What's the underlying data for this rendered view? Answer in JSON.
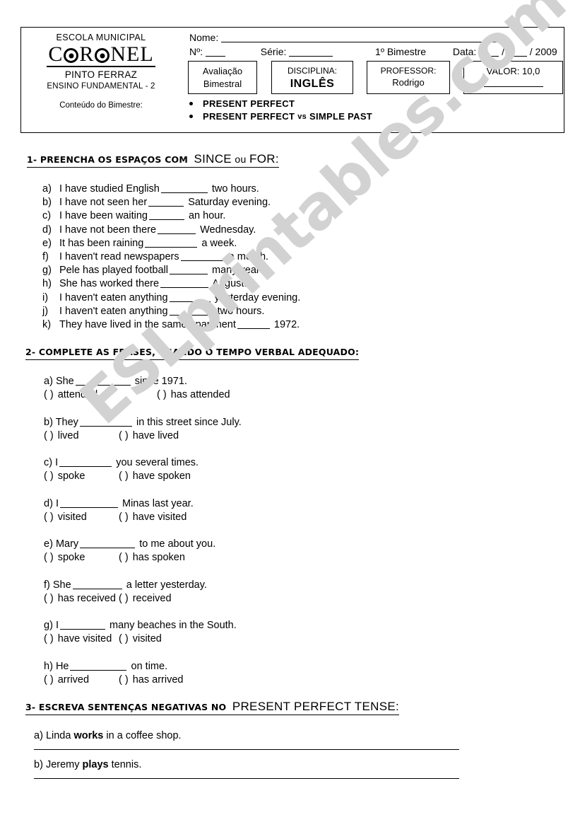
{
  "header": {
    "school": {
      "line1": "ESCOLA MUNICIPAL",
      "logo_part1": "C",
      "logo_part2": "R",
      "logo_part3": "NEL",
      "line3": "PINTO FERRAZ",
      "line4": "ENSINO FUNDAMENTAL - 2",
      "conteudo_label": "Conteúdo do Bimestre:"
    },
    "fields": {
      "nome_label": "Nome:",
      "numero_label": "Nº:",
      "serie_label": "Série:",
      "bimestre": "1º Bimestre",
      "data_label": "Data:",
      "data_sep1": "/",
      "data_sep2": "/ 2009"
    },
    "cells": {
      "avaliacao_line1": "Avaliação",
      "avaliacao_line2": "Bimestral",
      "disciplina_label": "DISCIPLINA:",
      "disciplina_value": "INGLÊS",
      "professor_label": "PROFESSOR:",
      "professor_value": "Rodrigo",
      "valor_label": "VALOR: 10,0"
    },
    "topics": [
      {
        "text": "PRESENT PERFECT"
      },
      {
        "part1": "PRESENT PERFECT",
        "part2": "vs",
        "part3": "SIMPLE PAST"
      }
    ]
  },
  "watermark": {
    "text": "ESLprintables.com",
    "color": "#d2d2d2"
  },
  "exercise1": {
    "heading_bold": "1- PREENCHA OS ESPAÇOS COM",
    "heading_light_1": "SINCE",
    "heading_light_2": "ou",
    "heading_light_3": "FOR:",
    "items": [
      {
        "letter": "a)",
        "before": "I have studied English",
        "blank": 66,
        "after": "two hours."
      },
      {
        "letter": "b)",
        "before": "I have not seen her",
        "blank": 50,
        "after": "Saturday evening."
      },
      {
        "letter": "c)",
        "before": "I have been waiting",
        "blank": 50,
        "after": "an hour."
      },
      {
        "letter": "d)",
        "before": "I have not been there",
        "blank": 54,
        "after": "Wednesday."
      },
      {
        "letter": "e)",
        "before": "It has been raining",
        "blank": 74,
        "after": "a week."
      },
      {
        "letter": "f)",
        "before": "I haven't read newspapers",
        "blank": 62,
        "after": "a month."
      },
      {
        "letter": "g)",
        "before": "Pele has played football",
        "blank": 54,
        "after": "many years."
      },
      {
        "letter": "h)",
        "before": "She has worked there",
        "blank": 68,
        "after": "August."
      },
      {
        "letter": "i)",
        "before": "I haven't eaten anything",
        "blank": 58,
        "after": "yesterday evening."
      },
      {
        "letter": "j)",
        "before": "I haven't eaten anything",
        "blank": 62,
        "after": "two hours."
      },
      {
        "letter": "k)",
        "before": "They have lived in the same apartment",
        "blank": 46,
        "after": "1972."
      }
    ]
  },
  "exercise2": {
    "heading_bold": "2- COMPLETE AS FRASES, USANDO O TEMPO VERBAL ADEQUADO:",
    "items": [
      {
        "letter": "a)",
        "before": "She",
        "blank": 78,
        "after": "since 1971.",
        "opt1": "attended",
        "opt2": "has attended",
        "opt_gap": 160
      },
      {
        "letter": "b)",
        "before": "They",
        "blank": 74,
        "after": "in this street since July.",
        "opt1": "lived",
        "opt2": "have lived",
        "opt_gap": 106
      },
      {
        "letter": "c)",
        "before": "I",
        "blank": 74,
        "after": "you several times.",
        "opt1": "spoke",
        "opt2": "have spoken",
        "opt_gap": 106
      },
      {
        "letter": "d)",
        "before": "I",
        "blank": 82,
        "after": "Minas last year.",
        "opt1": "visited",
        "opt2": "have visited",
        "opt_gap": 106
      },
      {
        "letter": "e)",
        "before": "Mary",
        "blank": 78,
        "after": "to me about you.",
        "opt1": "spoke",
        "opt2": "has spoken",
        "opt_gap": 106
      },
      {
        "letter": "f)",
        "before": "She",
        "blank": 70,
        "after": "a letter yesterday.",
        "opt1": "has received",
        "opt2": "received",
        "opt_gap": 106
      },
      {
        "letter": "g)",
        "before": "I",
        "blank": 64,
        "after": "many beaches in the South.",
        "opt1": "have visited",
        "opt2": "visited",
        "opt_gap": 106
      },
      {
        "letter": "h)",
        "before": "He",
        "blank": 80,
        "after": "on time.",
        "opt1": "arrived",
        "opt2": "has arrived",
        "opt_gap": 106
      }
    ],
    "paren_open": "(",
    "paren_close": ")"
  },
  "exercise3": {
    "heading_bold": "3- ESCREVA SENTENÇAS NEGATIVAS NO",
    "heading_light": "PRESENT PERFECT TENSE:",
    "items": [
      {
        "letter": "a)",
        "pre": "Linda",
        "strong": "works",
        "post": "in a coffee shop."
      },
      {
        "letter": "b)",
        "pre": "Jeremy",
        "strong": "plays",
        "post": "tennis."
      }
    ]
  }
}
